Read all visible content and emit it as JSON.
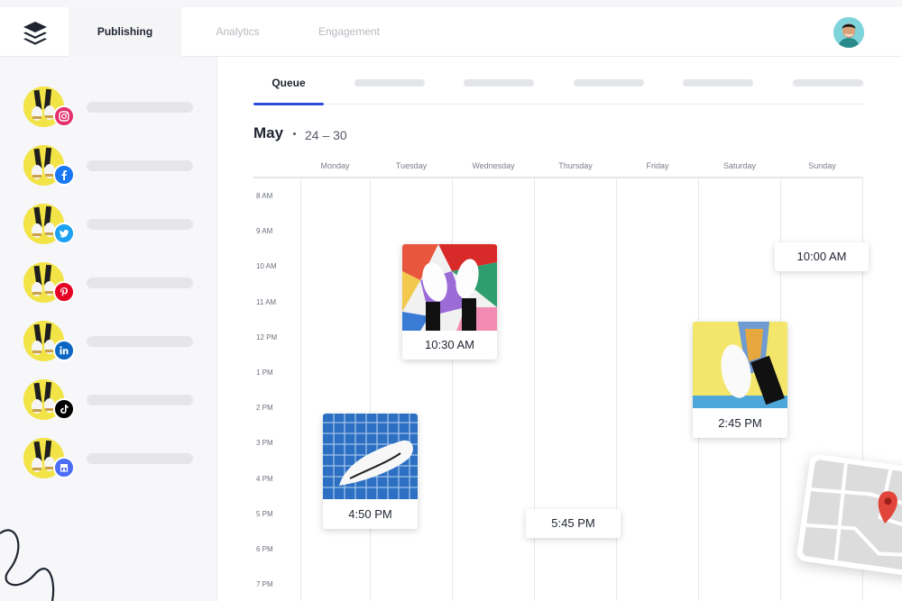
{
  "nav": {
    "tabs": [
      {
        "label": "Publishing",
        "active": true
      },
      {
        "label": "Analytics",
        "active": false
      },
      {
        "label": "Engagement",
        "active": false
      }
    ]
  },
  "sidebar": {
    "accounts": [
      {
        "network": "instagram",
        "icon": "instagram-icon",
        "color": "#e1306c"
      },
      {
        "network": "facebook",
        "icon": "facebook-icon",
        "color": "#1877f2"
      },
      {
        "network": "twitter",
        "icon": "twitter-icon",
        "color": "#1da1f2"
      },
      {
        "network": "pinterest",
        "icon": "pinterest-icon",
        "color": "#e60023"
      },
      {
        "network": "linkedin",
        "icon": "linkedin-icon",
        "color": "#0a66c2"
      },
      {
        "network": "tiktok",
        "icon": "tiktok-icon",
        "color": "#000000"
      },
      {
        "network": "google-business",
        "icon": "google-business-icon",
        "color": "#4a6cf7"
      }
    ]
  },
  "subtabs": {
    "active_label": "Queue"
  },
  "calendar": {
    "month": "May",
    "range": "24 – 30",
    "days": [
      "Monday",
      "Tuesday",
      "Wednesday",
      "Thursday",
      "Friday",
      "Saturday",
      "Sunday"
    ],
    "hours": [
      "8 AM",
      "9 AM",
      "10 AM",
      "11 AM",
      "12 PM",
      "1 PM",
      "2 PM",
      "3 PM",
      "4 PM",
      "5 PM",
      "6 PM",
      "7 PM"
    ]
  },
  "posts": [
    {
      "time": "10:30 AM",
      "day": "Tuesday",
      "image": "sneakers-colorful-floor"
    },
    {
      "time": "4:50 PM",
      "day": "Monday",
      "image": "sneakers-blue-grid"
    },
    {
      "time": "2:45 PM",
      "day": "Saturday",
      "image": "sneakers-yellow-wall"
    },
    {
      "time": "5:45 PM",
      "day": "Thursday"
    },
    {
      "time": "10:00 AM",
      "day": "Sunday"
    }
  ],
  "colors": {
    "accent": "#2c4bd8",
    "avatar_yellow": "#f2e447",
    "map_pin": "#e2463a"
  }
}
